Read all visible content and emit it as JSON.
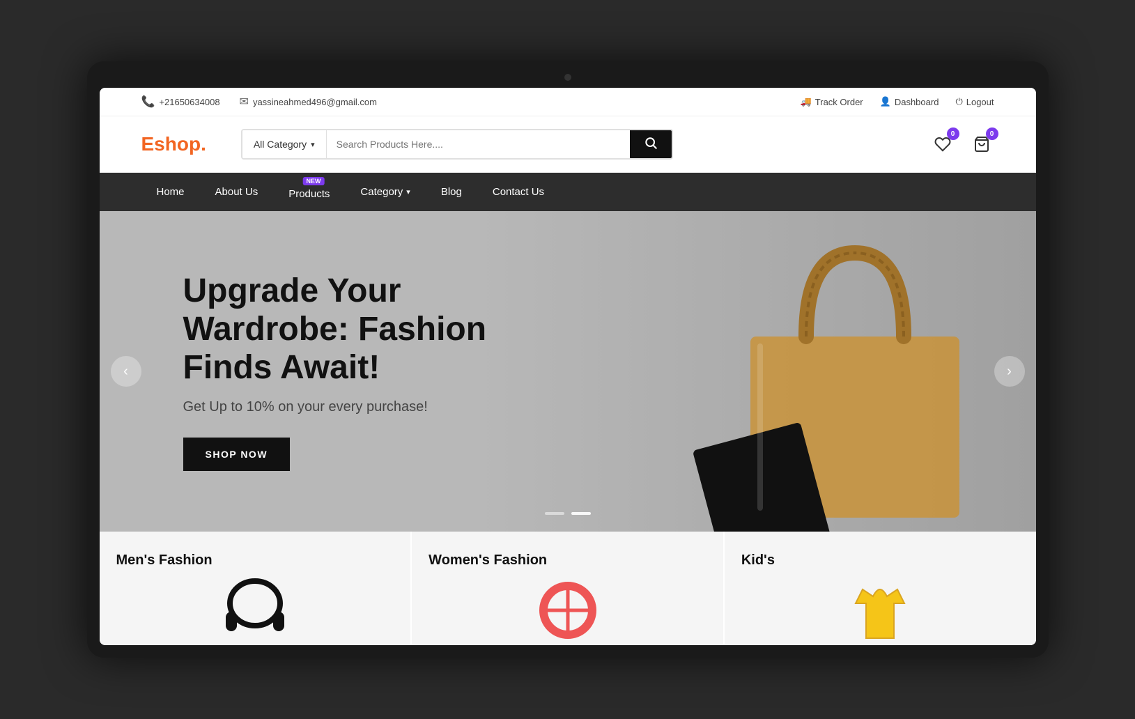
{
  "topbar": {
    "phone": "+21650634008",
    "email": "yassineahmed496@gmail.com",
    "track_order": "Track Order",
    "dashboard": "Dashboard",
    "logout": "Logout"
  },
  "header": {
    "logo_text": "Eshop",
    "logo_dot": ".",
    "category_label": "All Category",
    "search_placeholder": "Search Products Here....",
    "wishlist_count": "0",
    "cart_count": "0"
  },
  "nav": {
    "items": [
      {
        "label": "Home",
        "badge": null,
        "has_dropdown": false
      },
      {
        "label": "About Us",
        "badge": null,
        "has_dropdown": false
      },
      {
        "label": "Products",
        "badge": "NEW",
        "has_dropdown": false
      },
      {
        "label": "Category",
        "badge": null,
        "has_dropdown": true
      },
      {
        "label": "Blog",
        "badge": null,
        "has_dropdown": false
      },
      {
        "label": "Contact Us",
        "badge": null,
        "has_dropdown": false
      }
    ]
  },
  "hero": {
    "title": "Upgrade Your Wardrobe: Fashion Finds Await!",
    "subtitle": "Get Up to 10% on your every purchase!",
    "cta_label": "SHOP NOW",
    "slide_active": 1,
    "slide_total": 2
  },
  "categories": [
    {
      "title": "Men's Fashion"
    },
    {
      "title": "Women's Fashion"
    },
    {
      "title": "Kid's"
    }
  ]
}
